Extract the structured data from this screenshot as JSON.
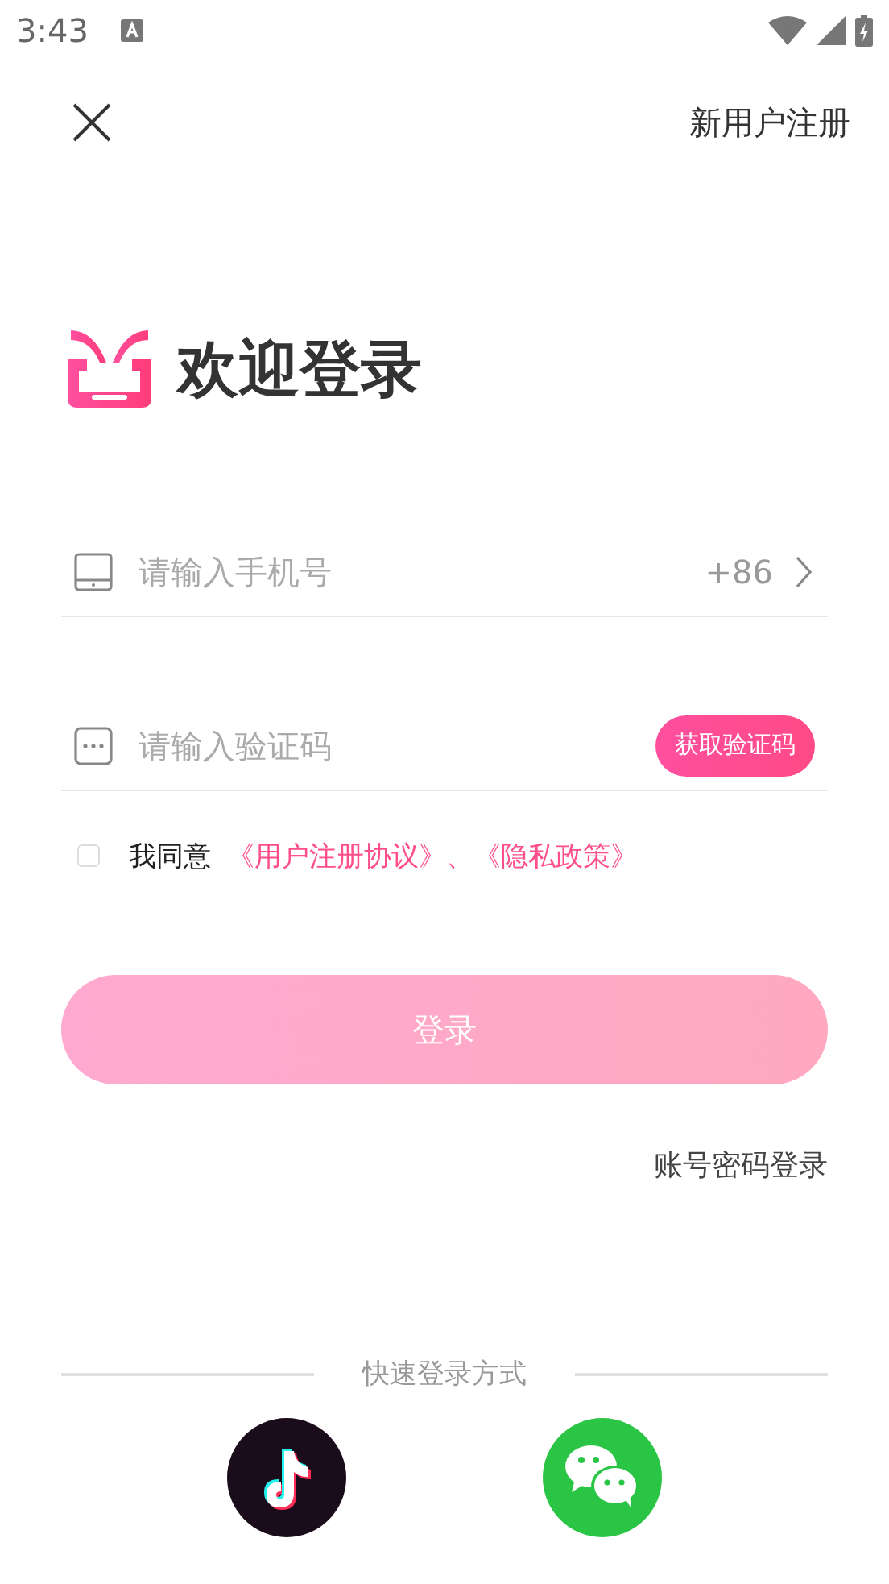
{
  "status_bar": {
    "time": "3:43"
  },
  "header": {
    "register_link": "新用户注册"
  },
  "title": "欢迎登录",
  "phone_field": {
    "placeholder": "请输入手机号",
    "country_code": "+86"
  },
  "code_field": {
    "placeholder": "请输入验证码",
    "get_code_button": "获取验证码"
  },
  "agreement": {
    "checked": false,
    "text": "我同意",
    "links": "《用户注册协议》、《隐私政策》"
  },
  "login_button": {
    "label": "登录",
    "disabled": true
  },
  "password_login": "账号密码登录",
  "quick_login": {
    "title": "快速登录方式",
    "providers": [
      {
        "kind": "tiktok"
      },
      {
        "kind": "wechat"
      }
    ]
  }
}
